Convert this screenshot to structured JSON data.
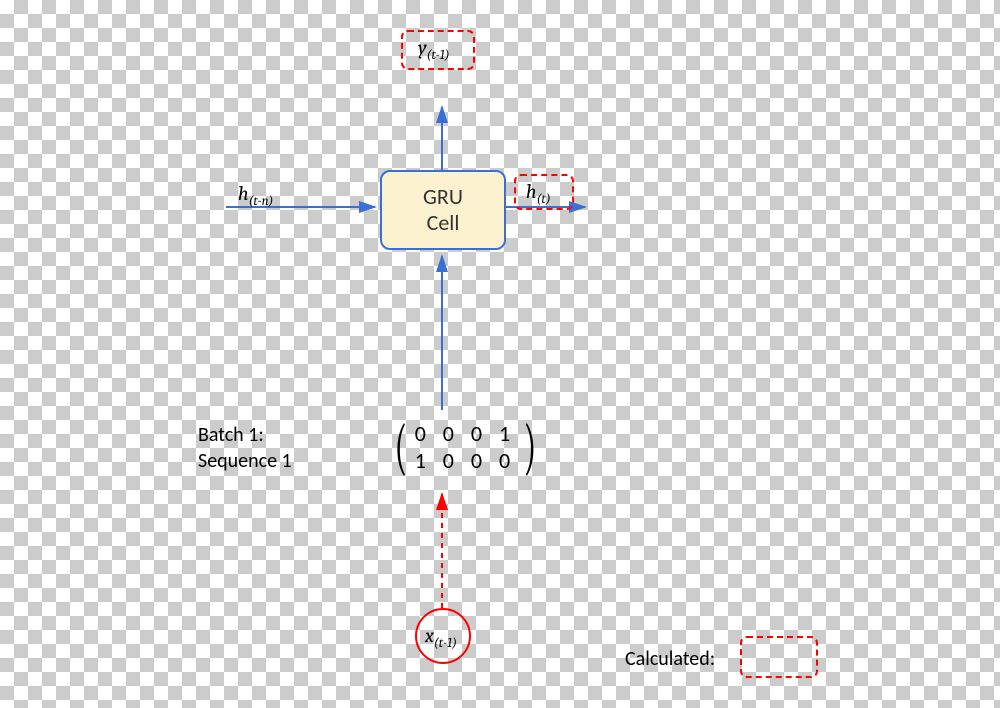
{
  "cell": {
    "line1": "GRU",
    "line2": "Cell"
  },
  "labels": {
    "h_in_base": "h",
    "h_in_sub": "(t-n)",
    "h_out_base": "h",
    "h_out_sub": "(t)",
    "y_base": "y",
    "y_sub": "(t-1)",
    "x_base": "x",
    "x_sub": "(t-1)",
    "batch_l1": "Batch 1:",
    "batch_l2": "Sequence 1",
    "legend": "Calculated:"
  },
  "matrix": {
    "row1": "0 0 0 1",
    "row2": "1 0 0 0"
  },
  "colors": {
    "arrow_blue": "#3a6fd8",
    "dashed_red": "#ff0000"
  }
}
